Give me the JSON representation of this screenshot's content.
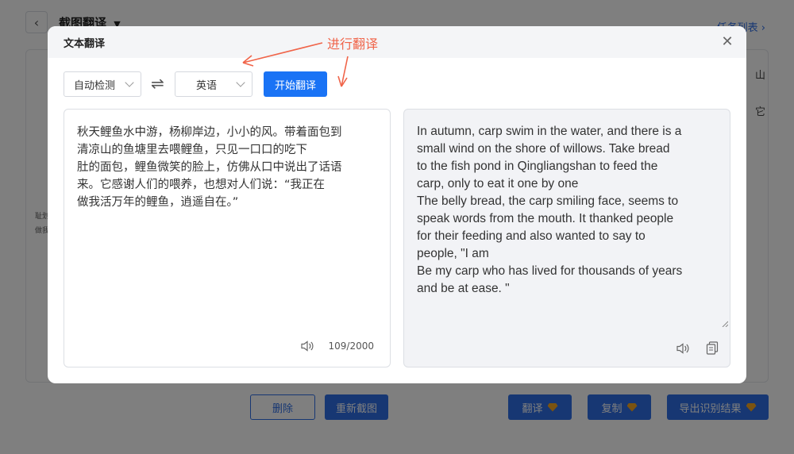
{
  "background": {
    "page_title": "截图翻译",
    "task_list_link": "任务列表",
    "side_text_1": "耻划",
    "side_text_2": "做我",
    "right_char_1": "山",
    "right_char_2": "它",
    "buttons": {
      "delete": "删除",
      "recapture": "重新截图",
      "translate": "翻译",
      "copy": "复制",
      "export": "导出识别结果"
    }
  },
  "modal": {
    "title": "文本翻译",
    "annotation": "进行翻译",
    "source_lang": "自动检测",
    "target_lang": "英语",
    "start_button": "开始翻译",
    "source_text": "秋天鲤鱼水中游，杨柳岸边，小小的风。带着面包到\n清凉山的鱼塘里去喂鲤鱼，只见一口口的吃下\n肚的面包，鲤鱼微笑的脸上，仿佛从口中说出了话语\n来。它感谢人们的喂养，也想对人们说：“我正在\n做我活万年的鲤鱼，逍遥自在。”",
    "char_count": "109/2000",
    "translated_text": "In autumn, carp swim in the water, and there is a\nsmall wind on the shore of willows. Take bread\nto the fish pond in Qingliangshan to feed the\ncarp, only to eat it one by one\nThe belly bread, the carp smiling face, seems to\nspeak words from the mouth. It thanked people\nfor their feeding and also wanted to say to\npeople, \"I am\nBe my carp who has lived for thousands of years\nand be at ease. \""
  },
  "icons": {
    "back": "chevron-left-icon",
    "dropdown": "caret-down-icon",
    "close": "close-icon",
    "swap": "swap-icon",
    "speaker": "speaker-icon",
    "copy": "copy-icon",
    "gem": "gem-icon"
  },
  "colors": {
    "accent": "#1a73f5",
    "annotation": "#f06449",
    "gem": "#f5a623"
  }
}
